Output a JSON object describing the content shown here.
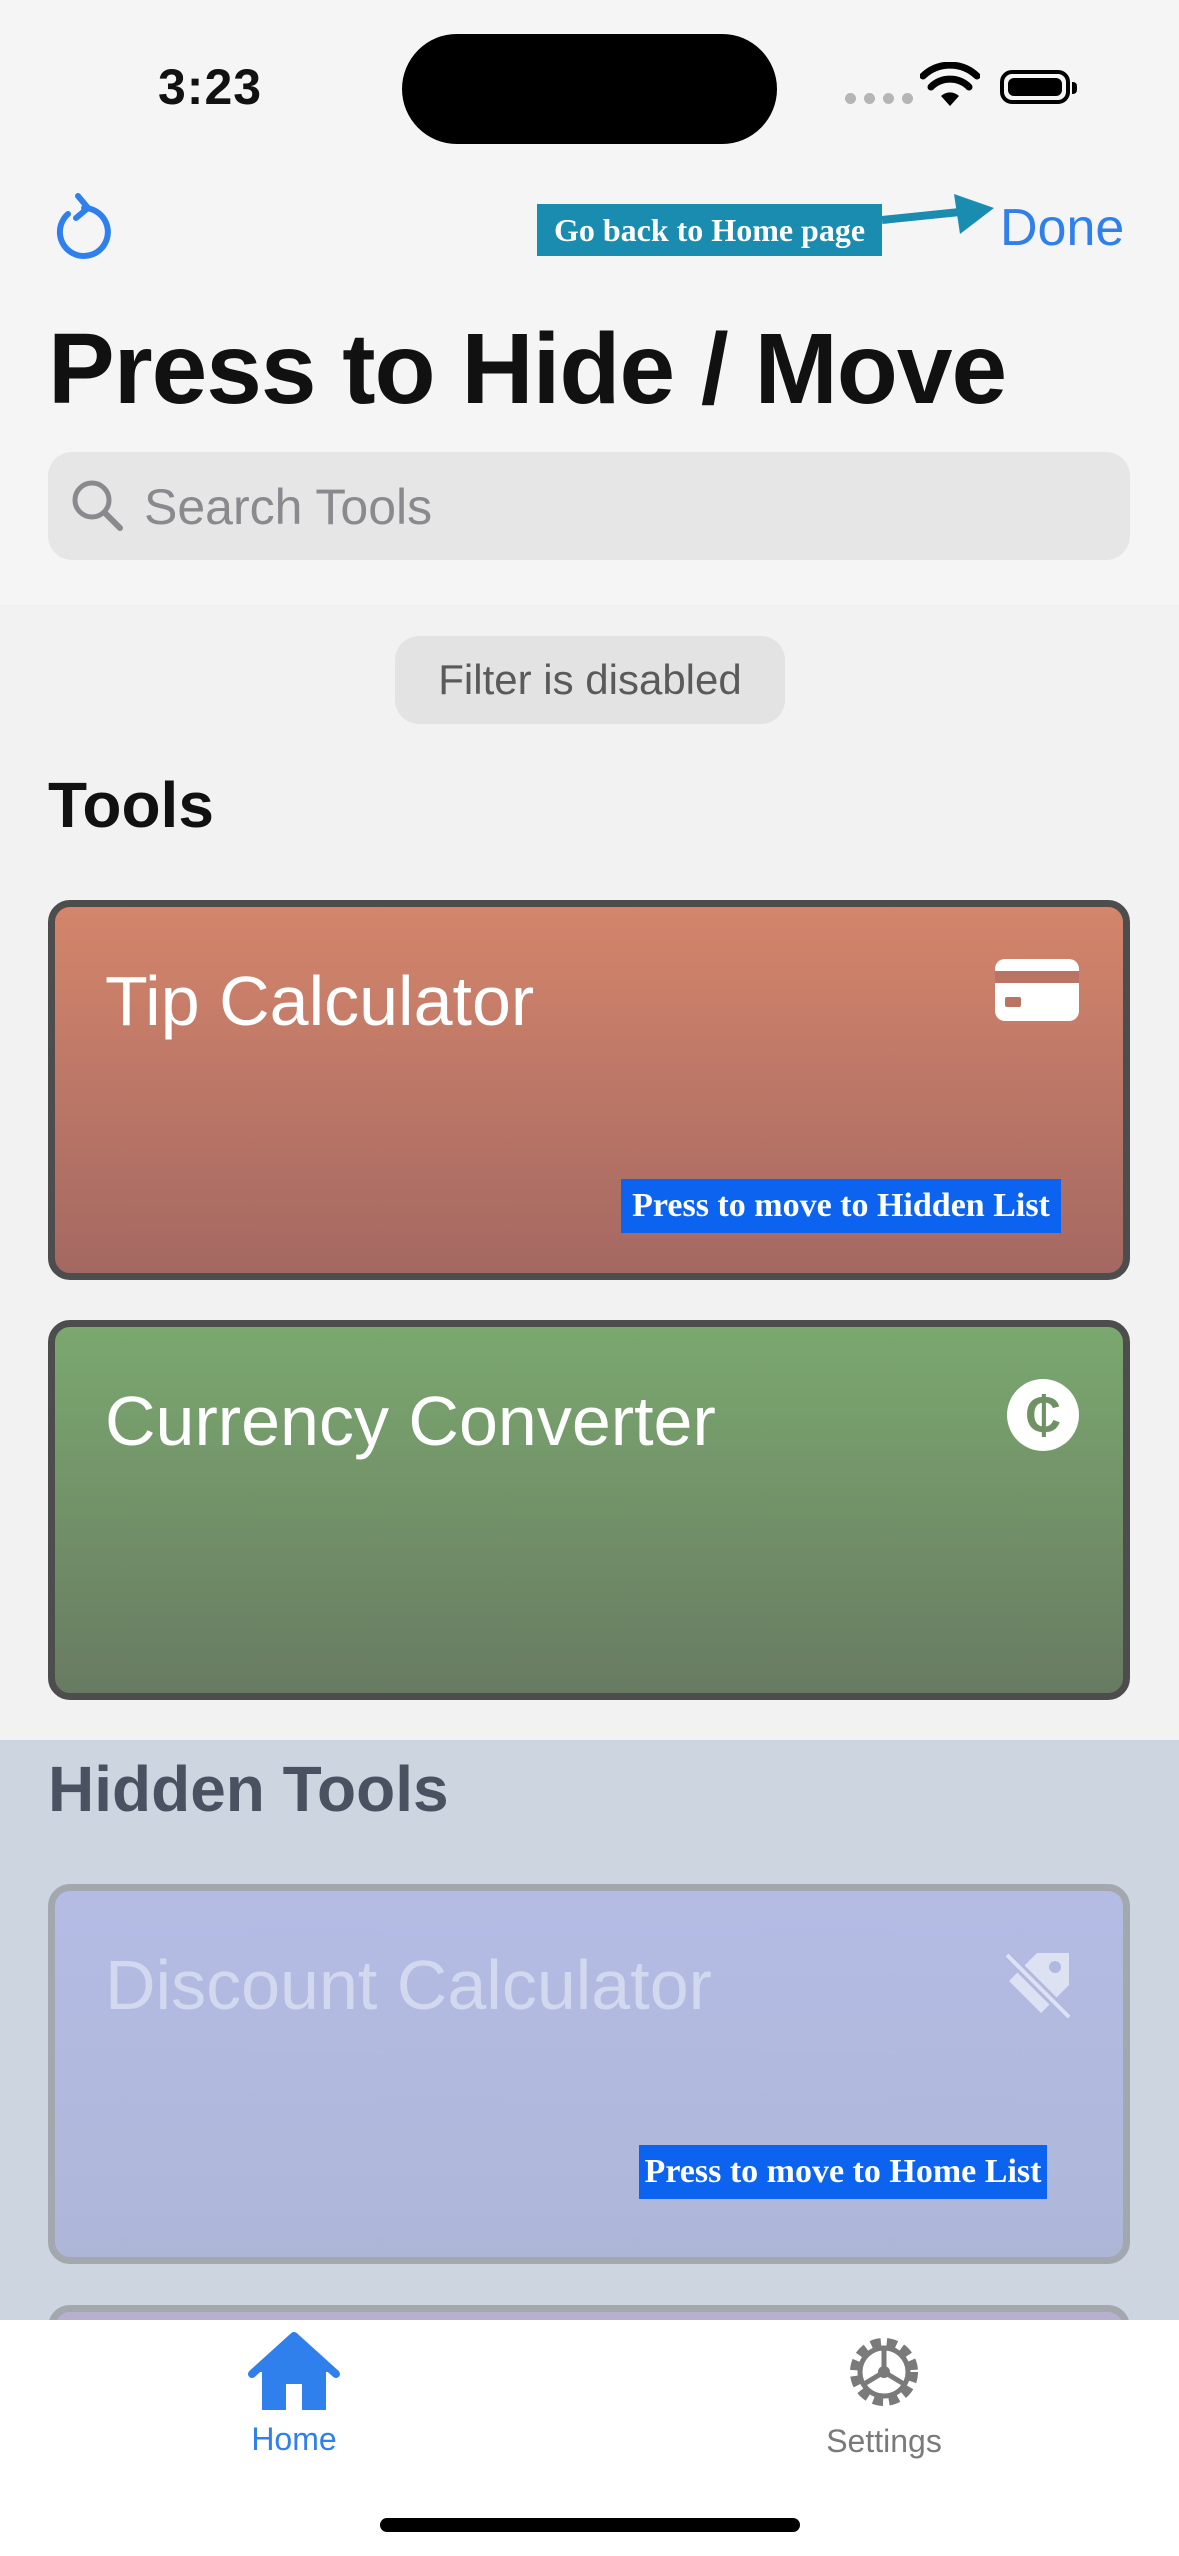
{
  "status_bar": {
    "time": "3:23"
  },
  "nav": {
    "done_label": "Done",
    "title": "Press to Hide / Move",
    "annotation_done": "Go back to Home page"
  },
  "search": {
    "placeholder": "Search Tools",
    "value": ""
  },
  "filter": {
    "label": "Filter is disabled"
  },
  "tools_section": {
    "title": "Tools",
    "cards": [
      {
        "title": "Tip Calculator",
        "icon": "credit-card-icon",
        "annotation": "Press to move to Hidden List"
      },
      {
        "title": "Currency Converter",
        "icon": "cedi-sign-icon",
        "icon_glyph": "₵"
      }
    ]
  },
  "hidden_section": {
    "title": "Hidden Tools",
    "cards": [
      {
        "title": "Discount Calculator",
        "icon": "tag-slash-icon",
        "annotation": "Press to move to Home List"
      }
    ]
  },
  "tabbar": {
    "items": [
      {
        "label": "Home",
        "icon": "house-icon",
        "active": true
      },
      {
        "label": "Settings",
        "icon": "gear-icon",
        "active": false
      }
    ]
  },
  "colors": {
    "accent": "#2f80ed",
    "annotation_teal": "#1a8cb0",
    "annotation_blue": "#0b63f0",
    "tip_card": "#c97b68",
    "currency_card": "#75986a",
    "discount_card": "#b2b9e0"
  }
}
